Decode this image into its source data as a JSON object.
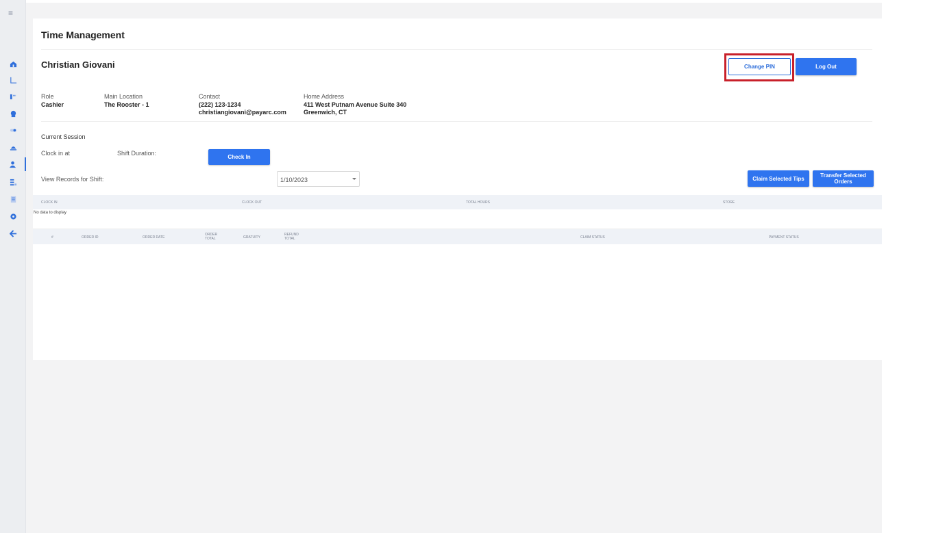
{
  "nav": {
    "items": [
      {
        "icon": "home-icon"
      },
      {
        "icon": "chart-icon"
      },
      {
        "icon": "tag-icon"
      },
      {
        "icon": "chef-hat-icon"
      },
      {
        "icon": "toggle-icon"
      },
      {
        "icon": "tray-icon"
      },
      {
        "icon": "person-icon"
      },
      {
        "icon": "list-icon"
      },
      {
        "icon": "document-icon"
      },
      {
        "icon": "gear-icon"
      },
      {
        "icon": "back-arrow-icon"
      }
    ],
    "active_index": 6,
    "accent": "#2f6fdb"
  },
  "page": {
    "title": "Time Management"
  },
  "employee": {
    "name": "Christian Giovani",
    "role_label": "Role",
    "role": "Cashier",
    "location_label": "Main Location",
    "location": "The Rooster - 1",
    "contact_label": "Contact",
    "phone": "(222) 123-1234",
    "email": "christiangiovani@payarc.com",
    "address_label": "Home Address",
    "address_line1": "411 West Putnam Avenue Suite 340",
    "address_line2": "Greenwich, CT"
  },
  "actions": {
    "change_pin": "Change PIN",
    "log_out": "Log Out",
    "check_in": "Check In",
    "claim_tips": "Claim Selected Tips",
    "transfer_orders_line1": "Transfer Selected",
    "transfer_orders_line2": "Orders"
  },
  "session": {
    "title": "Current Session",
    "clock_in_label": "Clock in at",
    "shift_duration_label": "Shift Duration:",
    "view_records_label": "View Records for Shift:",
    "shift_date": "1/10/2023"
  },
  "shift_table": {
    "columns": [
      "CLOCK IN",
      "CLOCK OUT",
      "TOTAL HOURS",
      "STORE"
    ],
    "empty_text": "No data to display"
  },
  "orders_table": {
    "columns": [
      "#",
      "ORDER ID",
      "ORDER DATE",
      "ORDER TOTAL",
      "GRATUITY",
      "REFUND TOTAL",
      "CLAIM STATUS",
      "PAYMENT STATUS"
    ]
  },
  "colors": {
    "primary": "#2f74ef",
    "highlight": "#c8202a"
  }
}
